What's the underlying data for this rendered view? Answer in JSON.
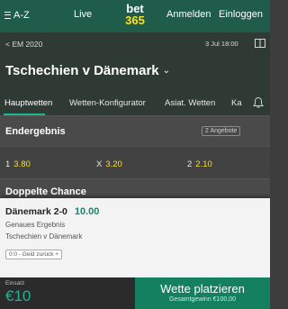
{
  "topbar": {
    "menu_label": "A-Z",
    "live_label": "Live",
    "logo_line1": "bet",
    "logo_line2": "365",
    "login_label": "Anmelden",
    "register_label": "Einloggen"
  },
  "event": {
    "breadcrumb": "EM 2020",
    "date": "3 Jul 18:00",
    "title": "Tschechien v Dänemark"
  },
  "tabs": [
    {
      "label": "Hauptwetten",
      "active": true
    },
    {
      "label": "Wetten-Konfigurator",
      "active": false
    },
    {
      "label": "Asiat. Wetten",
      "active": false
    },
    {
      "label": "Ka",
      "active": false
    }
  ],
  "markets": {
    "endergebnis": {
      "name": "Endergebnis",
      "offers": "2 Angebote",
      "odds": [
        {
          "label": "1",
          "price": "3.80"
        },
        {
          "label": "X",
          "price": "3.20"
        },
        {
          "label": "2",
          "price": "2.10"
        }
      ]
    },
    "doppelte_chance": {
      "name": "Doppelte Chance"
    }
  },
  "betslip": {
    "selection": "Dänemark 2-0",
    "odds": "10.00",
    "market": "Genaues Ergebnis",
    "event": "Tschechien v Dänemark",
    "cashout": "0:0 - Geld zurück +"
  },
  "bottom": {
    "stake_label": "Einsatz",
    "stake_value": "€10",
    "place_label": "Wette platzieren",
    "total_return": "Gesamtgewinn €100,00"
  },
  "colors": {
    "brand_green": "#1f5c49",
    "odds_yellow": "#ffdf1b",
    "accent_green": "#1fb58f"
  }
}
